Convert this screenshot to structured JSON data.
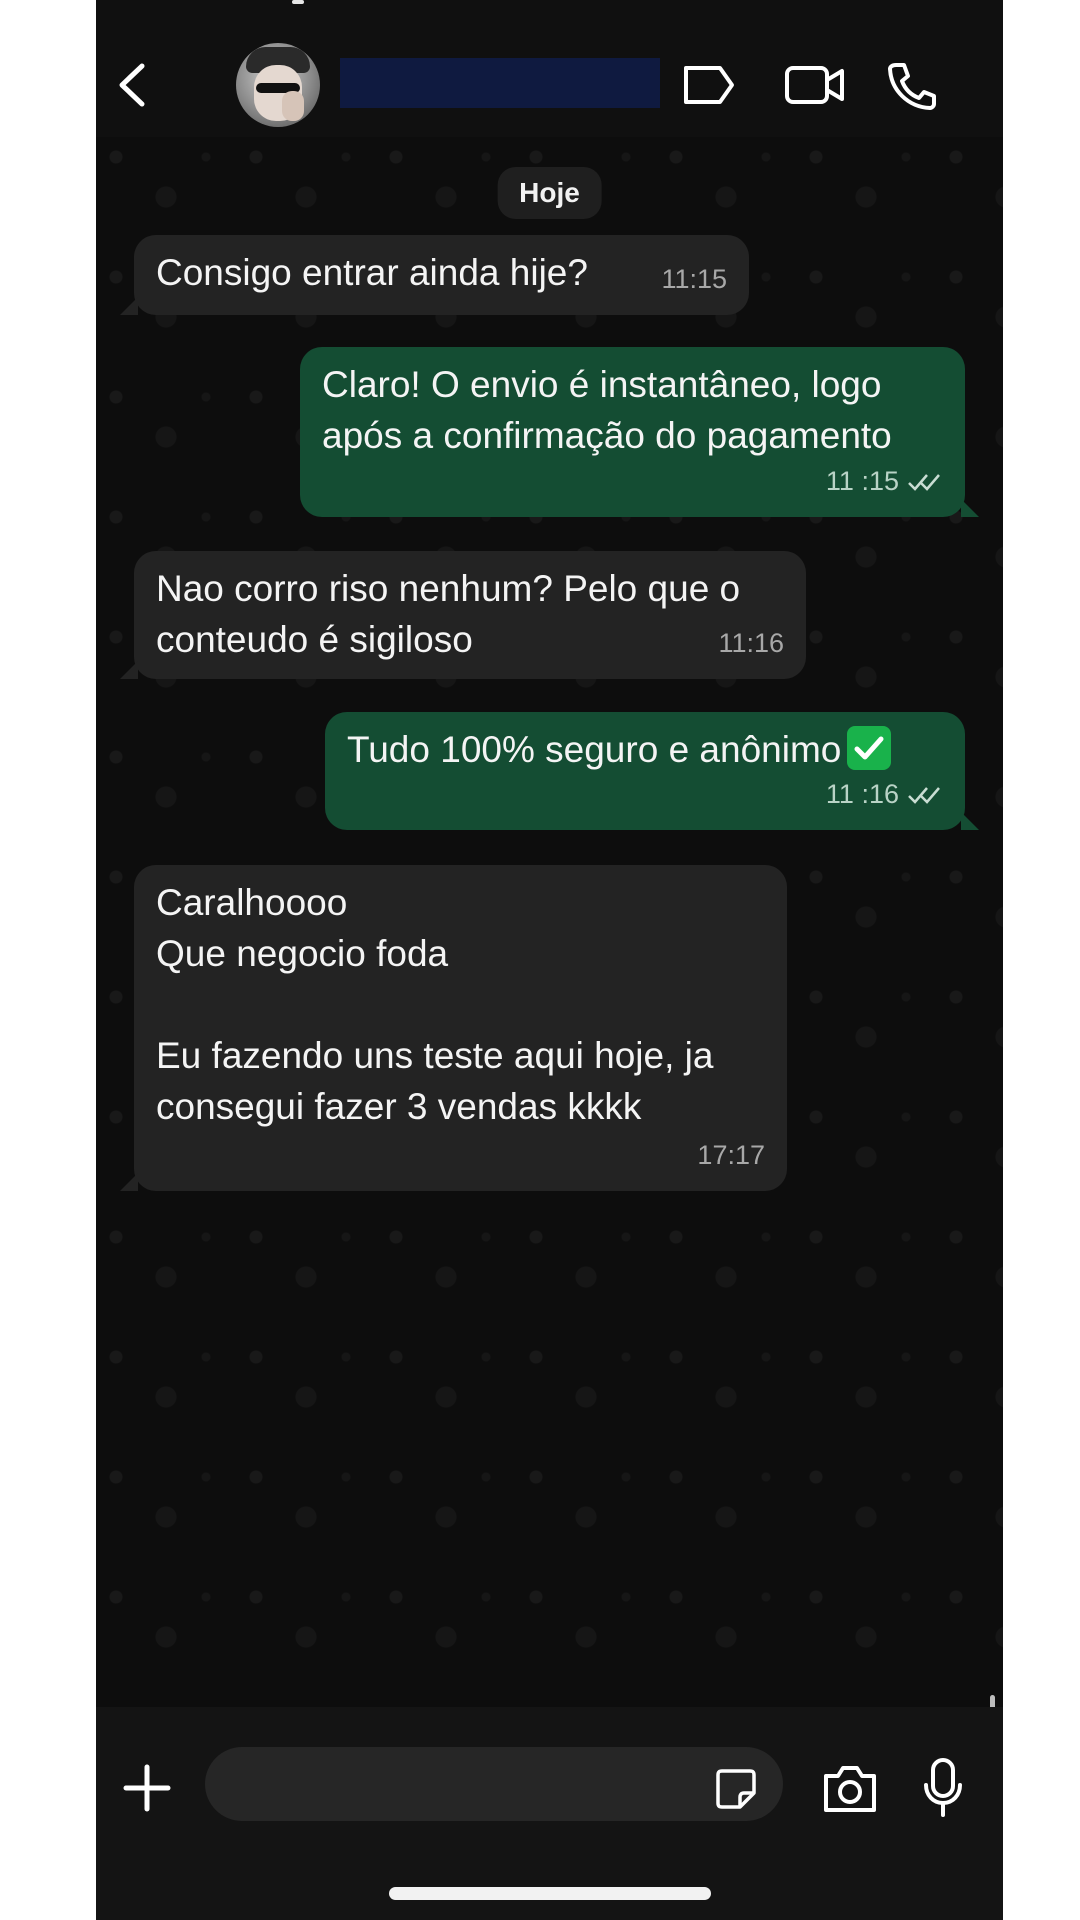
{
  "header": {
    "contact_name": "",
    "back_icon": "chevron-left-icon",
    "label_icon": "tag-icon",
    "video_icon": "video-camera-icon",
    "call_icon": "phone-icon"
  },
  "chat": {
    "date_separator": "Hoje",
    "messages": [
      {
        "direction": "incoming",
        "text": "Consigo entrar ainda hije?",
        "time": "11:15"
      },
      {
        "direction": "outgoing",
        "text": "Claro! O envio é instantâneo, logo\napós a confirmação do pagamento",
        "time": "11 :15",
        "status": "read"
      },
      {
        "direction": "incoming",
        "text": "Nao corro riso nenhum? Pelo que o\nconteudo é sigiloso",
        "time": "11:16"
      },
      {
        "direction": "outgoing",
        "text": "Tudo 100% seguro e anônimo",
        "emoji": "check-mark-button",
        "time": "11 :16",
        "status": "read"
      },
      {
        "direction": "incoming",
        "text": "Caralhoooo\nQue negocio foda\n\nEu fazendo uns teste aqui hoje, ja\nconsegui fazer 3 vendas kkkk",
        "time": "17:17"
      }
    ]
  },
  "footer": {
    "attach_icon": "plus-icon",
    "message_input_value": "",
    "sticker_icon": "sticker-icon",
    "camera_icon": "camera-icon",
    "mic_icon": "microphone-icon"
  },
  "colors": {
    "incoming_bubble": "#232323",
    "outgoing_bubble": "#144d33",
    "background": "#0d0d0d"
  }
}
